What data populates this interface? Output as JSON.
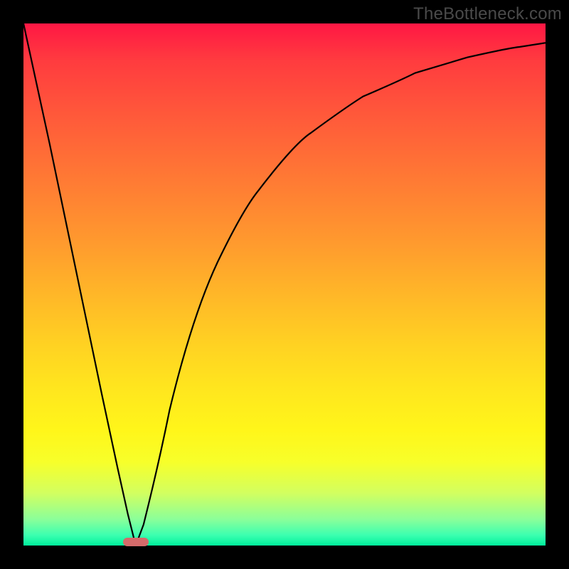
{
  "watermark": "TheBottleneck.com",
  "chart_data": {
    "type": "line",
    "title": "",
    "xlabel": "",
    "ylabel": "",
    "xlim": [
      0,
      100
    ],
    "ylim": [
      0,
      100
    ],
    "grid": false,
    "legend": false,
    "series": [
      {
        "name": "bottleneck-curve",
        "x": [
          0,
          5,
          10,
          15,
          18,
          20,
          21.5,
          23,
          25,
          28,
          32,
          38,
          45,
          55,
          65,
          75,
          85,
          95,
          100
        ],
        "y": [
          100,
          77,
          53,
          29,
          15,
          6,
          0,
          4,
          13,
          26,
          41,
          56,
          68,
          79,
          86,
          90.5,
          93.5,
          95.5,
          96.3
        ]
      }
    ],
    "optimum_marker": {
      "x_pct": 21.5,
      "width_pct": 5
    },
    "background_gradient": {
      "top": "#ff1744",
      "bottom": "#00f09c"
    }
  }
}
